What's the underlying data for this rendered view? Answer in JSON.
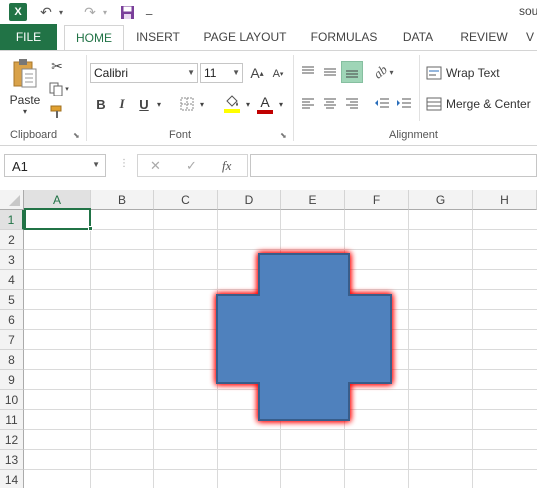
{
  "title": "sou",
  "tabs": [
    {
      "label": "FILE"
    },
    {
      "label": "HOME"
    },
    {
      "label": "INSERT"
    },
    {
      "label": "PAGE LAYOUT"
    },
    {
      "label": "FORMULAS"
    },
    {
      "label": "DATA"
    },
    {
      "label": "REVIEW"
    },
    {
      "label": "V"
    }
  ],
  "clipboard": {
    "paste_label": "Paste",
    "group_label": "Clipboard"
  },
  "font": {
    "name": "Calibri",
    "size": "11",
    "group_label": "Font",
    "bold": "B",
    "italic": "I",
    "underline": "U",
    "grow": "A",
    "shrink": "A",
    "font_color_glyph": "A",
    "font_color": "#c00000",
    "fill_color": "#ffff00"
  },
  "alignment": {
    "wrap_text": "Wrap Text",
    "merge_center": "Merge & Center",
    "group_label": "Alignment"
  },
  "formula_bar": {
    "name_box": "A1",
    "fx": "fx",
    "cancel": "✕",
    "enter": "✓",
    "value": ""
  },
  "columns": [
    "A",
    "B",
    "C",
    "D",
    "E",
    "F",
    "G",
    "H"
  ],
  "rows": [
    "1",
    "2",
    "3",
    "4",
    "5",
    "6",
    "7",
    "8",
    "9",
    "10",
    "11",
    "12",
    "13",
    "14"
  ],
  "selected_cell": "A1",
  "shape": {
    "type": "plus",
    "fill": "#4f81bd",
    "outline": "#385d8a",
    "glow": "#ff0000"
  },
  "colors": {
    "accent": "#217346"
  }
}
